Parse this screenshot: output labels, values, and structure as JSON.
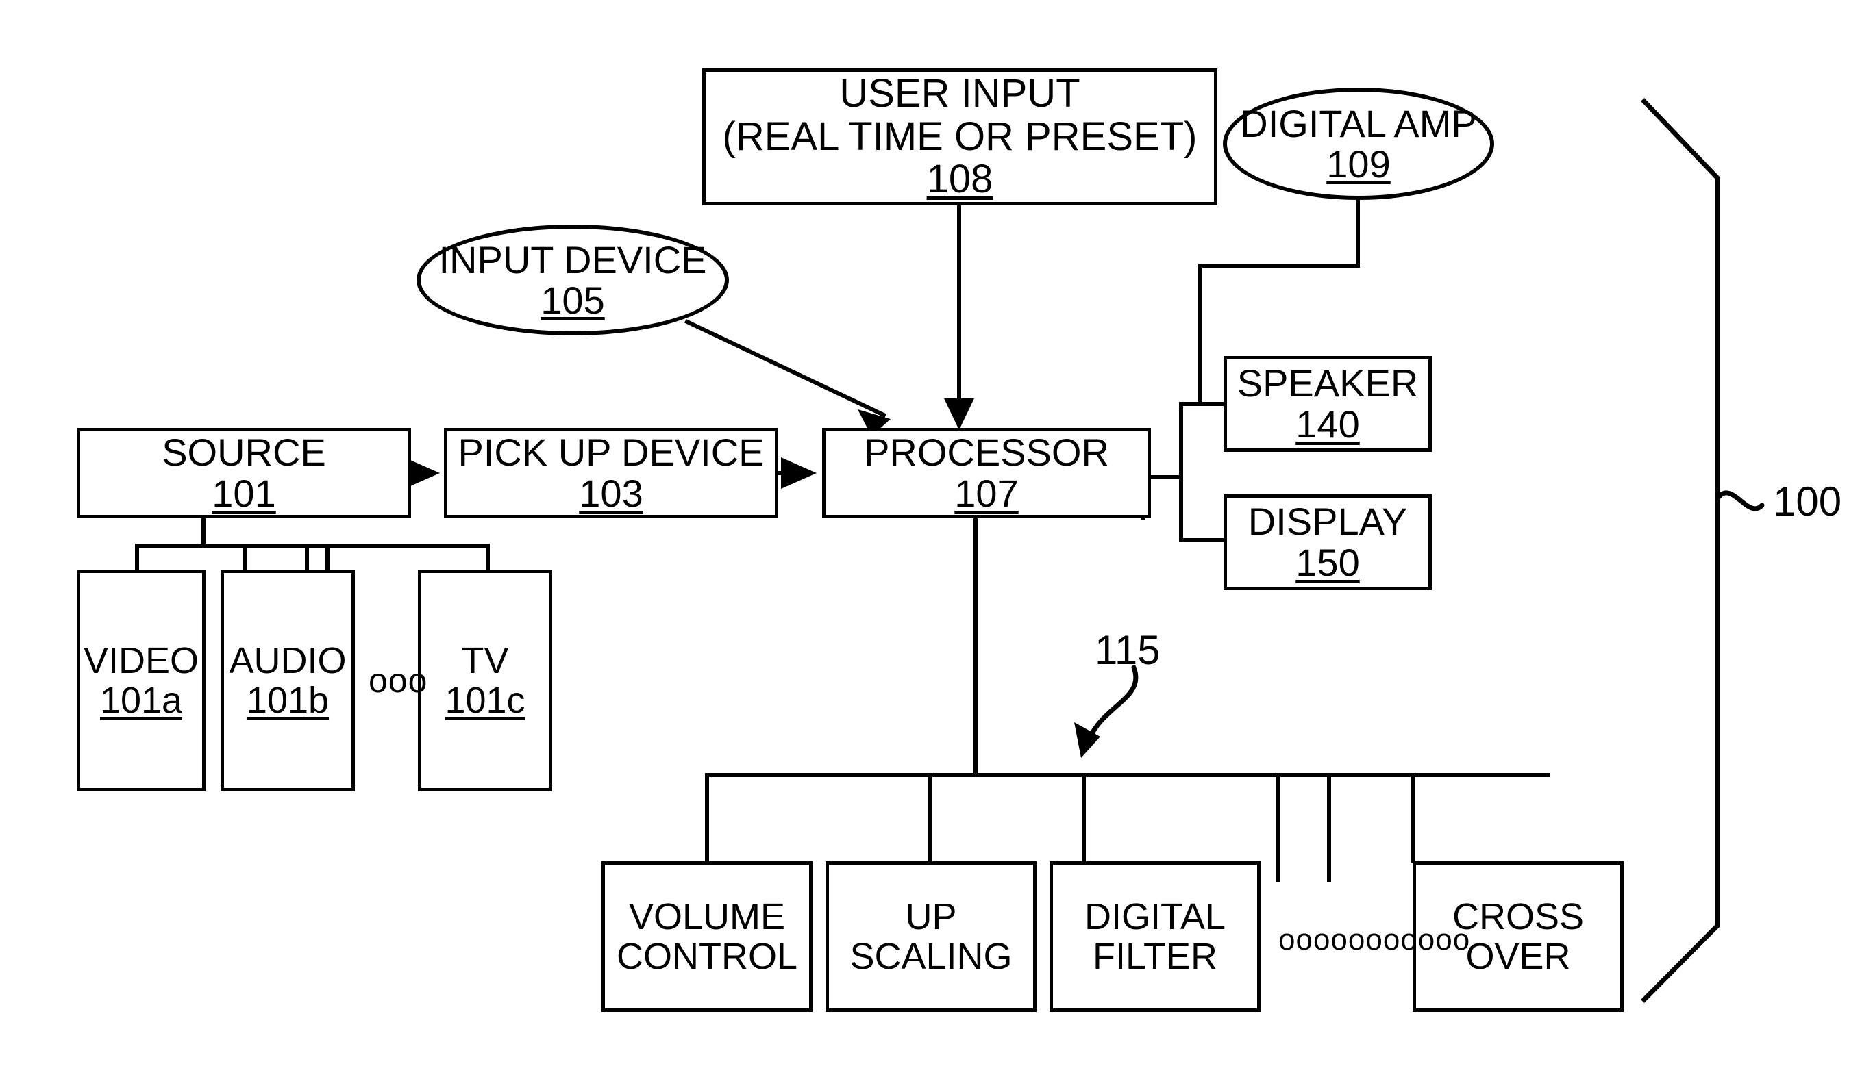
{
  "figure": {
    "reference_numeral": "100",
    "bus_reference": "115",
    "ellipsis_small": "ooo",
    "ellipsis_long": "ooooooooooo"
  },
  "nodes": {
    "user_input": {
      "label": "USER INPUT\n(REAL TIME OR PRESET)",
      "ref": "108"
    },
    "digital_amp": {
      "label": "DIGITAL AMP",
      "ref": "109"
    },
    "input_device": {
      "label": "INPUT DEVICE",
      "ref": "105"
    },
    "source": {
      "label": "SOURCE",
      "ref": "101"
    },
    "pickup": {
      "label": "PICK UP DEVICE",
      "ref": "103"
    },
    "processor": {
      "label": "PROCESSOR",
      "ref": "107"
    },
    "speaker": {
      "label": "SPEAKER",
      "ref": "140"
    },
    "display": {
      "label": "DISPLAY",
      "ref": "150"
    },
    "video": {
      "label": "VIDEO",
      "ref": "101a"
    },
    "audio": {
      "label": "AUDIO",
      "ref": "101b"
    },
    "tv": {
      "label": "TV",
      "ref": "101c"
    },
    "volume_control": {
      "label": "VOLUME\nCONTROL",
      "ref": ""
    },
    "up_scaling": {
      "label": "UP\nSCALING",
      "ref": ""
    },
    "digital_filter": {
      "label": "DIGITAL\nFILTER",
      "ref": ""
    },
    "cross_over": {
      "label": "CROSS\nOVER",
      "ref": ""
    }
  },
  "colors": {
    "ink": "#000000",
    "paper": "#ffffff"
  }
}
